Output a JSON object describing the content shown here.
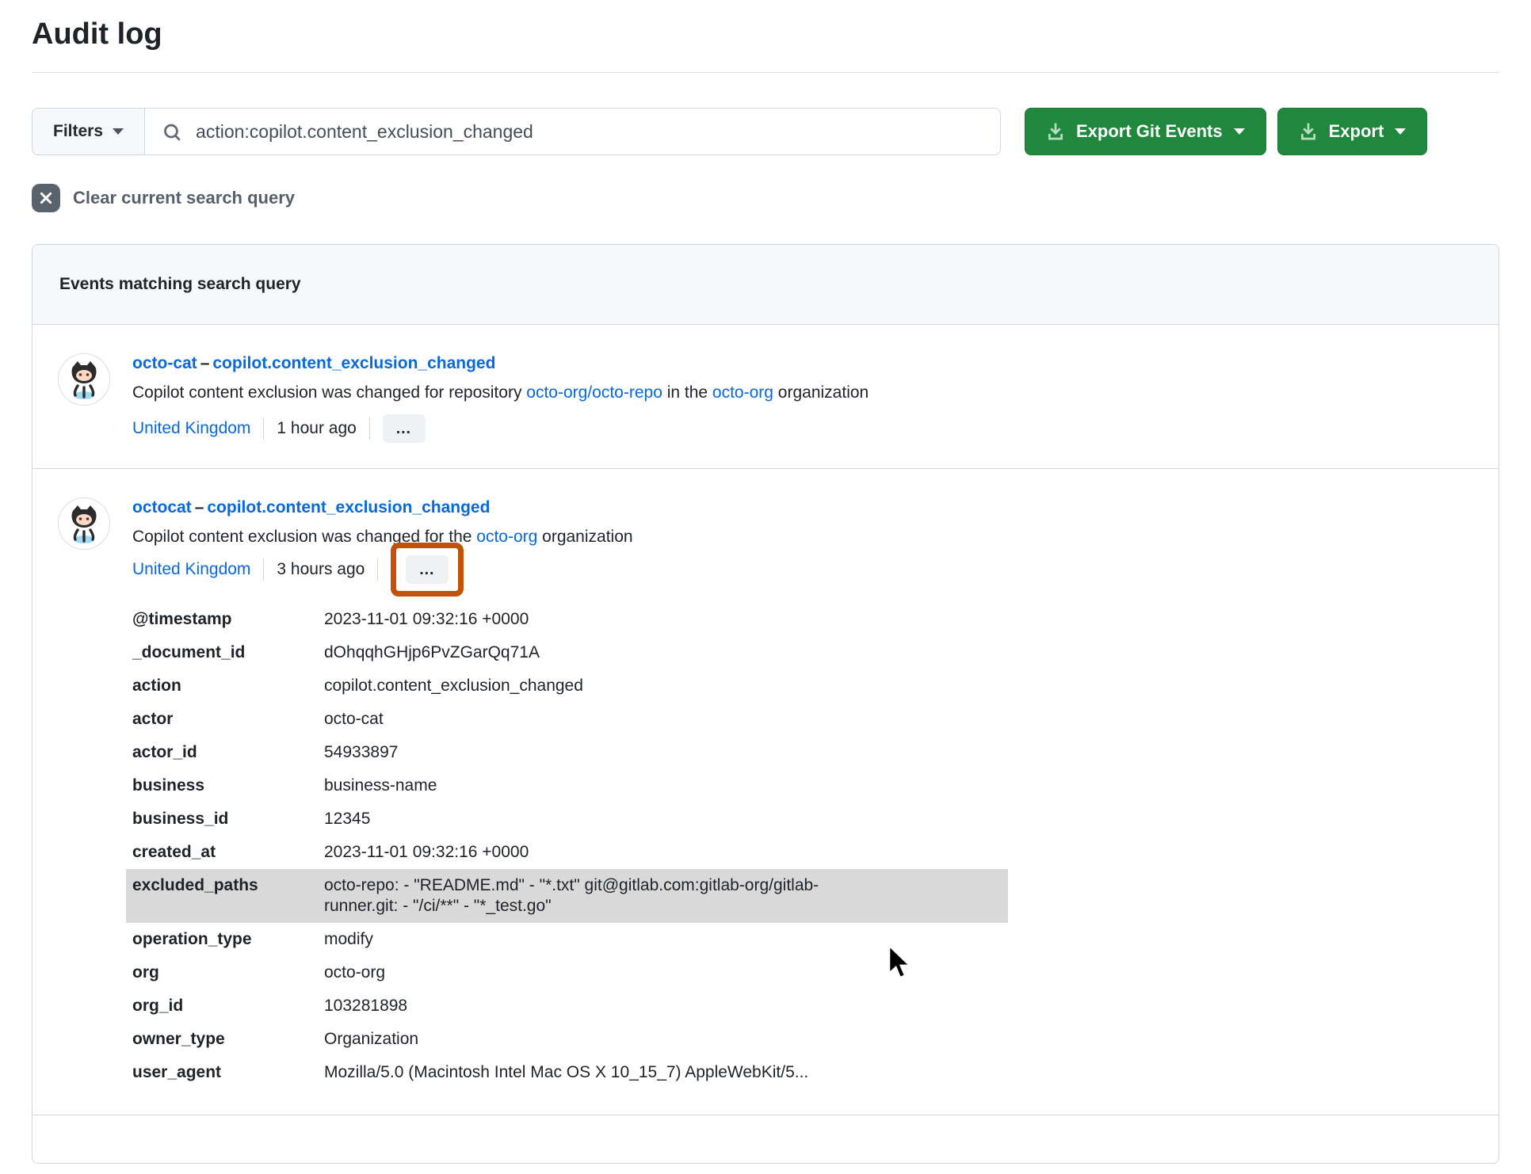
{
  "page": {
    "title": "Audit log"
  },
  "toolbar": {
    "filters_label": "Filters",
    "search_value": "action:copilot.content_exclusion_changed",
    "export_git_events_label": "Export Git Events",
    "export_label": "Export"
  },
  "clear_search": {
    "label": "Clear current search query"
  },
  "panel": {
    "header": "Events matching search query"
  },
  "events": [
    {
      "actor": "octo-cat",
      "separator": "–",
      "action": "copilot.content_exclusion_changed",
      "description": [
        {
          "text": "Copilot content exclusion was changed for repository ",
          "link": false
        },
        {
          "text": "octo-org/octo-repo",
          "link": true
        },
        {
          "text": " in the ",
          "link": false
        },
        {
          "text": "octo-org",
          "link": true
        },
        {
          "text": " organization",
          "link": false
        }
      ],
      "location": "United Kingdom",
      "time": "1 hour ago",
      "more_label": "…"
    },
    {
      "actor": "octocat",
      "separator": "–",
      "action": "copilot.content_exclusion_changed",
      "description": [
        {
          "text": "Copilot content exclusion was changed for the ",
          "link": false
        },
        {
          "text": "octo-org",
          "link": true
        },
        {
          "text": " organization",
          "link": false
        }
      ],
      "location": "United Kingdom",
      "time": "3 hours ago",
      "more_label": "…",
      "annotated": true
    }
  ],
  "details": {
    "rows": [
      {
        "key": "@timestamp",
        "value": "2023-11-01 09:32:16 +0000"
      },
      {
        "key": "_document_id",
        "value": "dOhqqhGHjp6PvZGarQq71A"
      },
      {
        "key": "action",
        "value": "copilot.content_exclusion_changed"
      },
      {
        "key": "actor",
        "value": "octo-cat"
      },
      {
        "key": "actor_id",
        "value": "54933897"
      },
      {
        "key": "business",
        "value": "business-name"
      },
      {
        "key": "business_id",
        "value": "12345"
      },
      {
        "key": "created_at",
        "value": "2023-11-01 09:32:16 +0000"
      },
      {
        "key": "excluded_paths",
        "value": "octo-repo: - \"README.md\" - \"*.txt\" git@gitlab.com:gitlab-org/gitlab-runner.git: - \"/ci/**\" - \"*_test.go\"",
        "highlight": true
      },
      {
        "key": "operation_type",
        "value": "modify"
      },
      {
        "key": "org",
        "value": "octo-org"
      },
      {
        "key": "org_id",
        "value": "103281898"
      },
      {
        "key": "owner_type",
        "value": "Organization"
      },
      {
        "key": "user_agent",
        "value": "Mozilla/5.0 (Macintosh Intel Mac OS X 10_15_7) AppleWebKit/5..."
      }
    ]
  },
  "icons": {
    "search": "search-icon",
    "download": "download-icon",
    "caret": "chevron-down-icon",
    "clear": "circle-x-icon",
    "avatar": "octocat-avatar",
    "cursor": "mouse-cursor"
  },
  "colors": {
    "accent_green": "#1f883d",
    "link_blue": "#0969da",
    "annotation_orange": "#c4510a",
    "highlight_gray": "#d9d9d9",
    "border_gray": "#d0d7de"
  }
}
